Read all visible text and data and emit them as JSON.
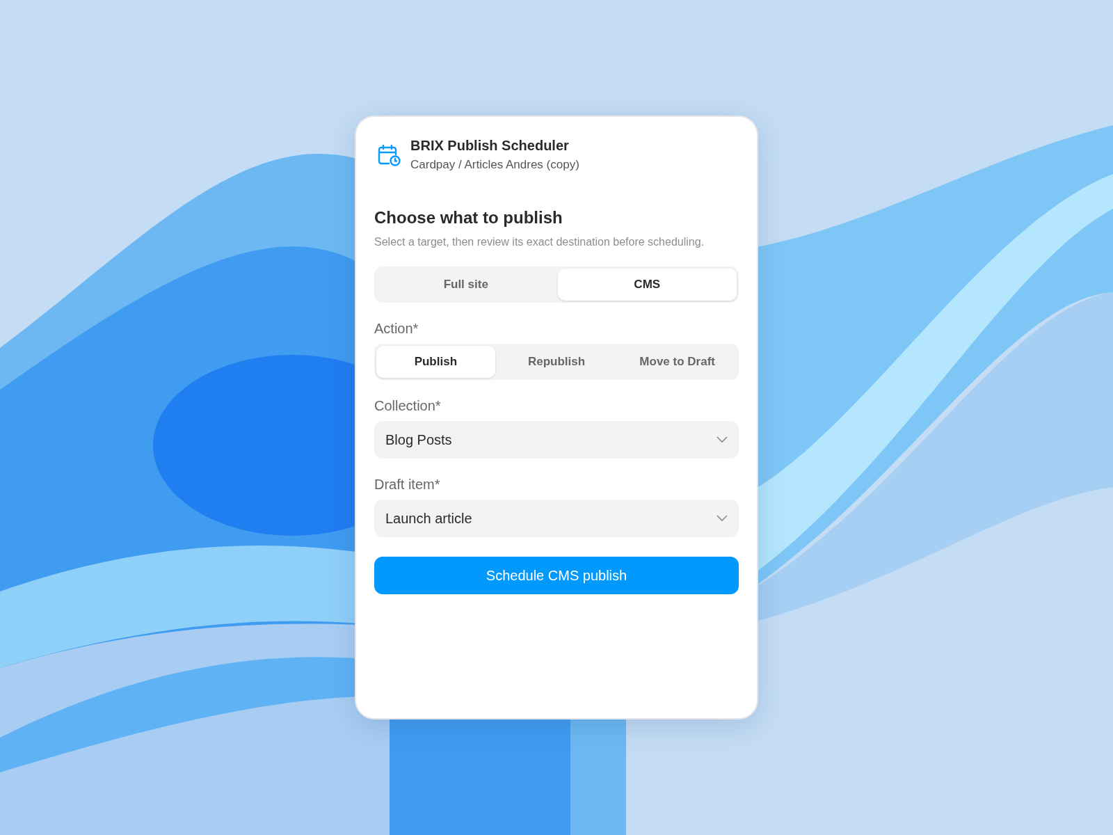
{
  "header": {
    "title": "BRIX Publish Scheduler",
    "subtitle": "Cardpay / Articles Andres (copy)"
  },
  "heading": "Choose what to publish",
  "description": "Select a target, then review its exact destination before scheduling.",
  "target_tabs": [
    {
      "label": "Full site",
      "selected": false
    },
    {
      "label": "CMS",
      "selected": true
    }
  ],
  "action": {
    "label": "Action*",
    "options": [
      {
        "label": "Publish",
        "selected": true
      },
      {
        "label": "Republish",
        "selected": false
      },
      {
        "label": "Move to Draft",
        "selected": false
      }
    ]
  },
  "fields": [
    {
      "label": "Collection*",
      "value": "Blog Posts"
    },
    {
      "label": "Draft item*",
      "value": "Launch article"
    }
  ],
  "submit_button": "Schedule CMS publish"
}
